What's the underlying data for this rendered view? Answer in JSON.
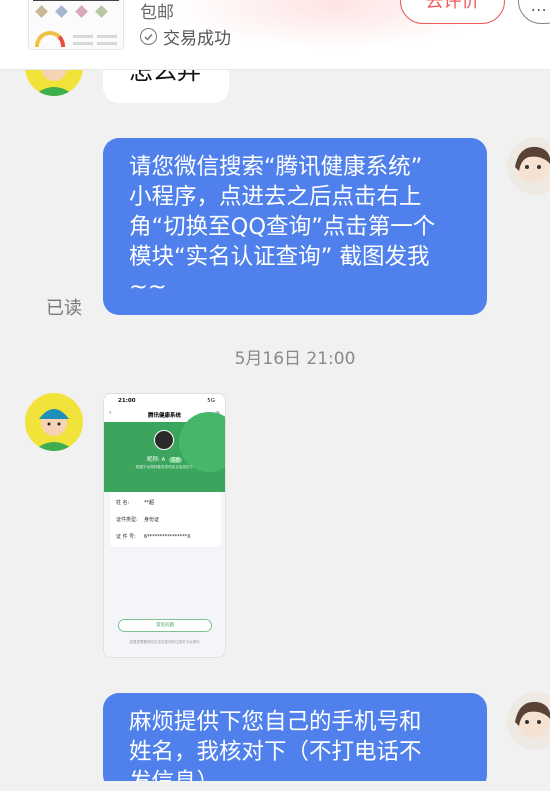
{
  "order": {
    "shipping_label": "包邮",
    "status_text": "交易成功",
    "review_button_label": "去评价",
    "more_button_label": "···"
  },
  "messages": {
    "partial_left_text": "怎么弄",
    "bubble1": {
      "lines": [
        "请您微信搜索“腾讯健康系统”",
        "小程序，点进去之后点击右上",
        "角“切换至QQ查询”点击第一个",
        "模块“实名认证查询” 截图发我",
        "~~"
      ],
      "read_status": "已读"
    },
    "timestamp": "5月16日 21:00",
    "screenshot": {
      "time": "21:00",
      "signal": "5G",
      "nav_title": "腾讯健康系统",
      "nickname_label": "昵称:",
      "nickname_value": "A",
      "tag": "实名",
      "subtitle": "根据平台规则要求您的实名信息如下",
      "rows": [
        {
          "key": "姓    名:",
          "value": "**超"
        },
        {
          "key": "证件类型:",
          "value": "身份证"
        },
        {
          "key": "证 件 号:",
          "value": "6****************X"
        }
      ],
      "button_label": "常见问题",
      "footer": "如果您需要修改实名信息请前往相关平台操作"
    },
    "bubble2": {
      "lines": [
        "麻烦提供下您自己的手机号和",
        "姓名，我核对下（不打电话不",
        "发信息）"
      ]
    }
  },
  "colors": {
    "accent_blue": "#4f80ec",
    "review_red": "#f25a5a",
    "mini_program_green": "#3ba55d"
  }
}
